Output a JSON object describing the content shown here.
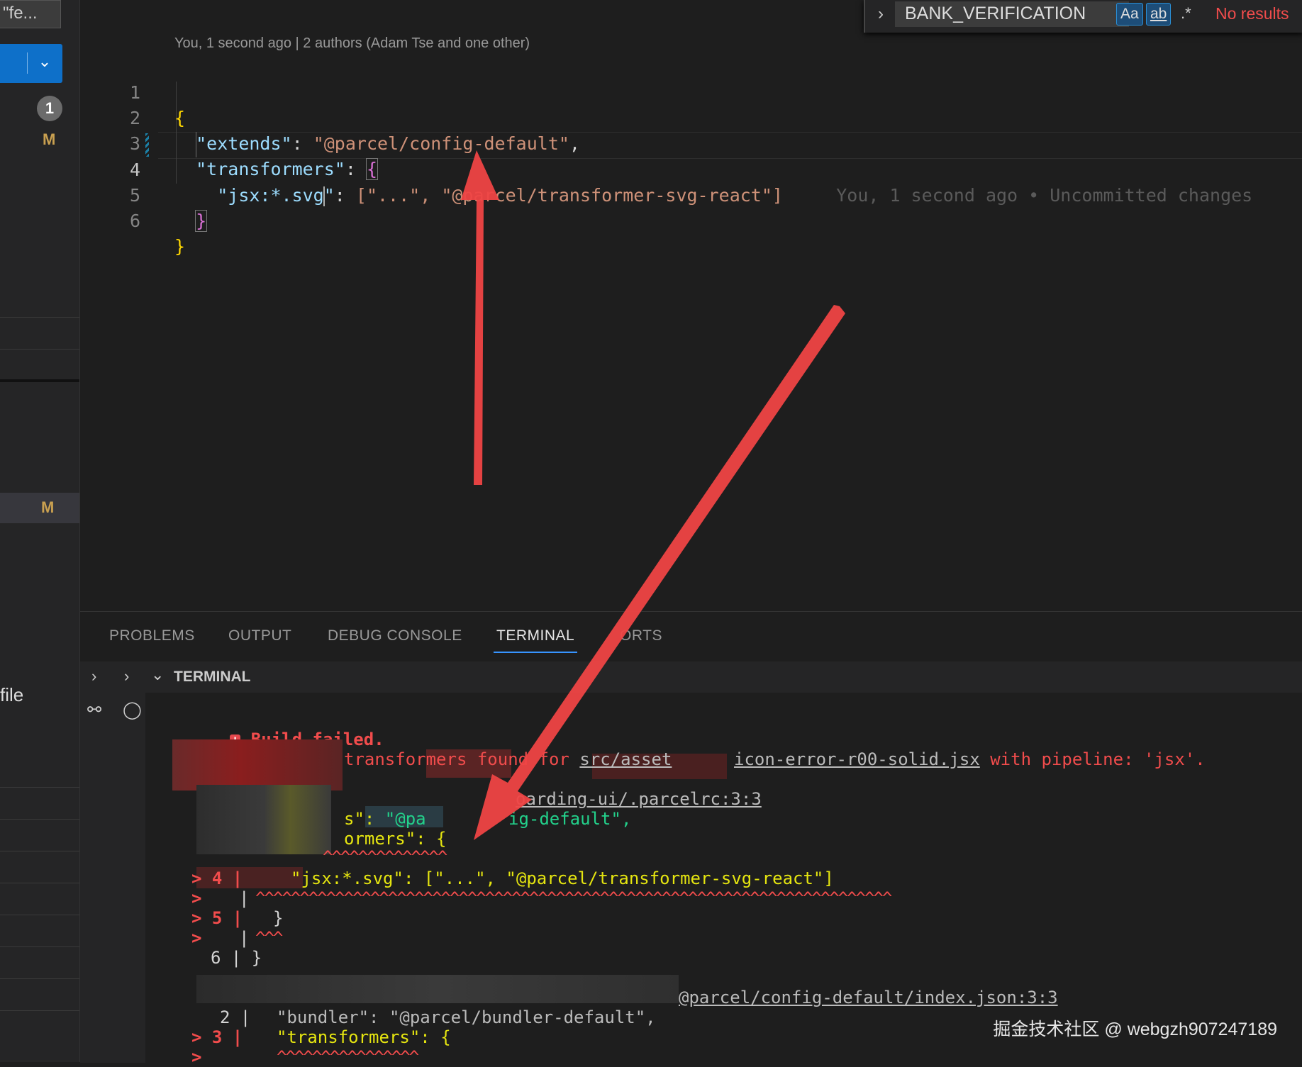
{
  "sidebar": {
    "search_value": "\"fe...",
    "badge_count": "1",
    "modified_flag_1": "M",
    "modified_flag_2": "M",
    "file_label": "file"
  },
  "find_widget": {
    "query": "BANK_VERIFICATION",
    "match_case_label": "Aa",
    "whole_word_label": "ab",
    "regex_label": ".*",
    "result_text": "No results"
  },
  "editor": {
    "blame_header": "You, 1 second ago | 2 authors (Adam Tse and one other)",
    "line_numbers": [
      "1",
      "2",
      "3",
      "4",
      "5",
      "6"
    ],
    "code": {
      "open_brace": "{",
      "extends_key": "\"extends\"",
      "extends_value": "\"@parcel/config-default\"",
      "transformers_key": "\"transformers\"",
      "open_bracket": "{",
      "jsx_key_a": "\"jsx:*.svg",
      "jsx_key_b": "\"",
      "jsx_value": "[\"...\", \"@parcel/transformer-svg-react\"]",
      "close_bracket": "}",
      "close_brace": "}"
    },
    "inline_blame": "You, 1 second ago • Uncommitted changes"
  },
  "panel": {
    "tabs": [
      "PROBLEMS",
      "OUTPUT",
      "DEBUG CONSOLE",
      "TERMINAL",
      "ORTS"
    ],
    "active_tab": "TERMINAL",
    "terminal_title": "TERMINAL"
  },
  "terminal": {
    "build_failed": "Build failed.",
    "error_msg_a": "transformers found for ",
    "error_path_a": "src/asset",
    "error_path_b": "icon-error-r00-solid.jsx",
    "error_msg_b": " with pipeline: 'jsx'.",
    "config_ref": "oarding-ui/.parcelrc:3:3",
    "snippet_extends_a": "s\": ",
    "snippet_extends_b": "\"@pa",
    "snippet_extends_c": "ig-default\",",
    "snippet_transformers": "ormers\": {",
    "squiggle_short": "^^^^^^^^^^^^^^",
    "line4_marker": "> 4 |",
    "line4_code": "\"jsx:*.svg\": [\"...\", \"@parcel/transformer-svg-react\"]",
    "marker_empty": "> ",
    "pipe": "|",
    "squiggle_long": "^^^^^^^^^^^^^^^^^^^^^^^^^^^^^^^^^^^^^^^^^^^^^^^^^^^^^^^^^^^^^^^^^^^^^^^^",
    "line5_marker": "> 5 |",
    "line5_code": "}",
    "squiggle_tiny": "^^^",
    "line6": "6 | }",
    "default_config_ref": "@parcel/config-default/index.json:3:3",
    "line2": "2 |",
    "line2_code": "\"bundler\": \"@parcel/bundler-default\",",
    "line3_marker": "> 3 |",
    "line3_code": "\"transformers\": {",
    "squiggle_mid": "^^^^^^^^^^^^^^^^"
  },
  "watermark": "掘金技术社区 @ webgzh907247189",
  "colors": {
    "accent": "#0e70c9",
    "error": "#f14c4c",
    "annotation_arrow": "#ef4444"
  }
}
